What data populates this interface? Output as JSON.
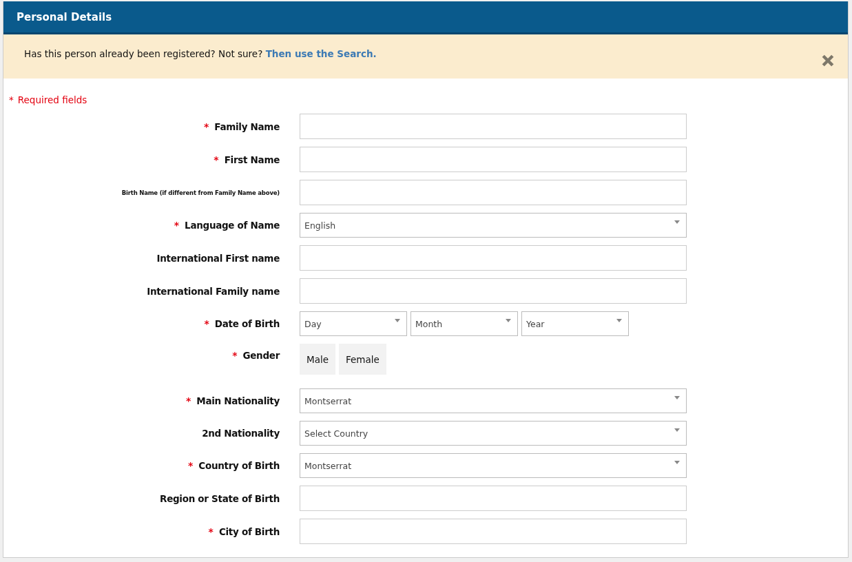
{
  "panel": {
    "title": "Personal Details"
  },
  "notice": {
    "text": "Has this person already been registered? Not sure?",
    "link": "Then use the Search."
  },
  "required_note": {
    "mark": "*",
    "text": "Required fields"
  },
  "fields": [
    {
      "kind": "text",
      "label": "Family Name",
      "required": true
    },
    {
      "kind": "text",
      "label": "First Name",
      "required": true
    },
    {
      "kind": "text",
      "label": "Birth Name (if different from Family Name above)",
      "required": false,
      "small_label": true
    },
    {
      "kind": "select",
      "label": "Language of Name",
      "required": true,
      "value": "English"
    },
    {
      "kind": "text",
      "label": "International First name",
      "required": false
    },
    {
      "kind": "text",
      "label": "International Family name",
      "required": false
    },
    {
      "kind": "date",
      "label": "Date of Birth",
      "required": true,
      "parts": [
        "Day",
        "Month",
        "Year"
      ]
    },
    {
      "kind": "choice",
      "label": "Gender",
      "required": true,
      "options": [
        {
          "label": "Male",
          "selected": false
        },
        {
          "label": "Female",
          "selected": false
        }
      ]
    },
    {
      "kind": "select",
      "label": "Main Nationality",
      "required": true,
      "value": "Montserrat"
    },
    {
      "kind": "select",
      "label": "2nd Nationality",
      "required": false,
      "value": "Select Country"
    },
    {
      "kind": "select",
      "label": "Country of Birth",
      "required": true,
      "value": "Montserrat"
    },
    {
      "kind": "text",
      "label": "Region or State of Birth",
      "required": false
    },
    {
      "kind": "text",
      "label": "City of Birth",
      "required": true
    }
  ]
}
